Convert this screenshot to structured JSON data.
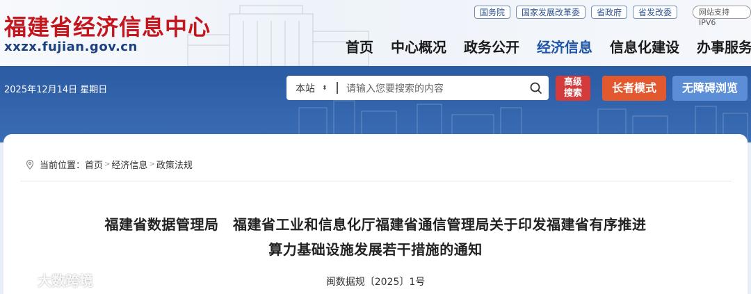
{
  "header": {
    "site_title": "福建省经济信息中心",
    "site_domain": "xxzx.fujian.gov.cn",
    "top_links": [
      "国务院",
      "国家发展改革委",
      "省政府",
      "省发改委"
    ],
    "ipv6": "网站支持IPV6",
    "nav": [
      {
        "label": "首页",
        "active": false
      },
      {
        "label": "中心概况",
        "active": false
      },
      {
        "label": "政务公开",
        "active": false
      },
      {
        "label": "经济信息",
        "active": true
      },
      {
        "label": "信息化建设",
        "active": false
      },
      {
        "label": "办事服务",
        "active": false
      }
    ]
  },
  "toolbar": {
    "date": "2025年12月14日 星期日",
    "search_scope": "本站",
    "search_placeholder": "请输入您要搜索的内容",
    "advanced_search": "高级\n搜索",
    "elder_mode": "长者模式",
    "accessible_browse": "无障碍浏览"
  },
  "breadcrumb": {
    "prefix": "当前位置：",
    "items": [
      "首页",
      "经济信息",
      "政策法规"
    ]
  },
  "article": {
    "title_line1": "福建省数据管理局　福建省工业和信息化厅福建省通信管理局关于印发福建省有序推进",
    "title_line2": "算力基础设施发展若干措施的通知",
    "doc_number": "闽数据规〔2025〕1号"
  },
  "watermark": "大数跨境",
  "colors": {
    "brand_red": "#c4161c",
    "band_blue": "#2f62aa",
    "nav_active": "#1f55a8"
  }
}
